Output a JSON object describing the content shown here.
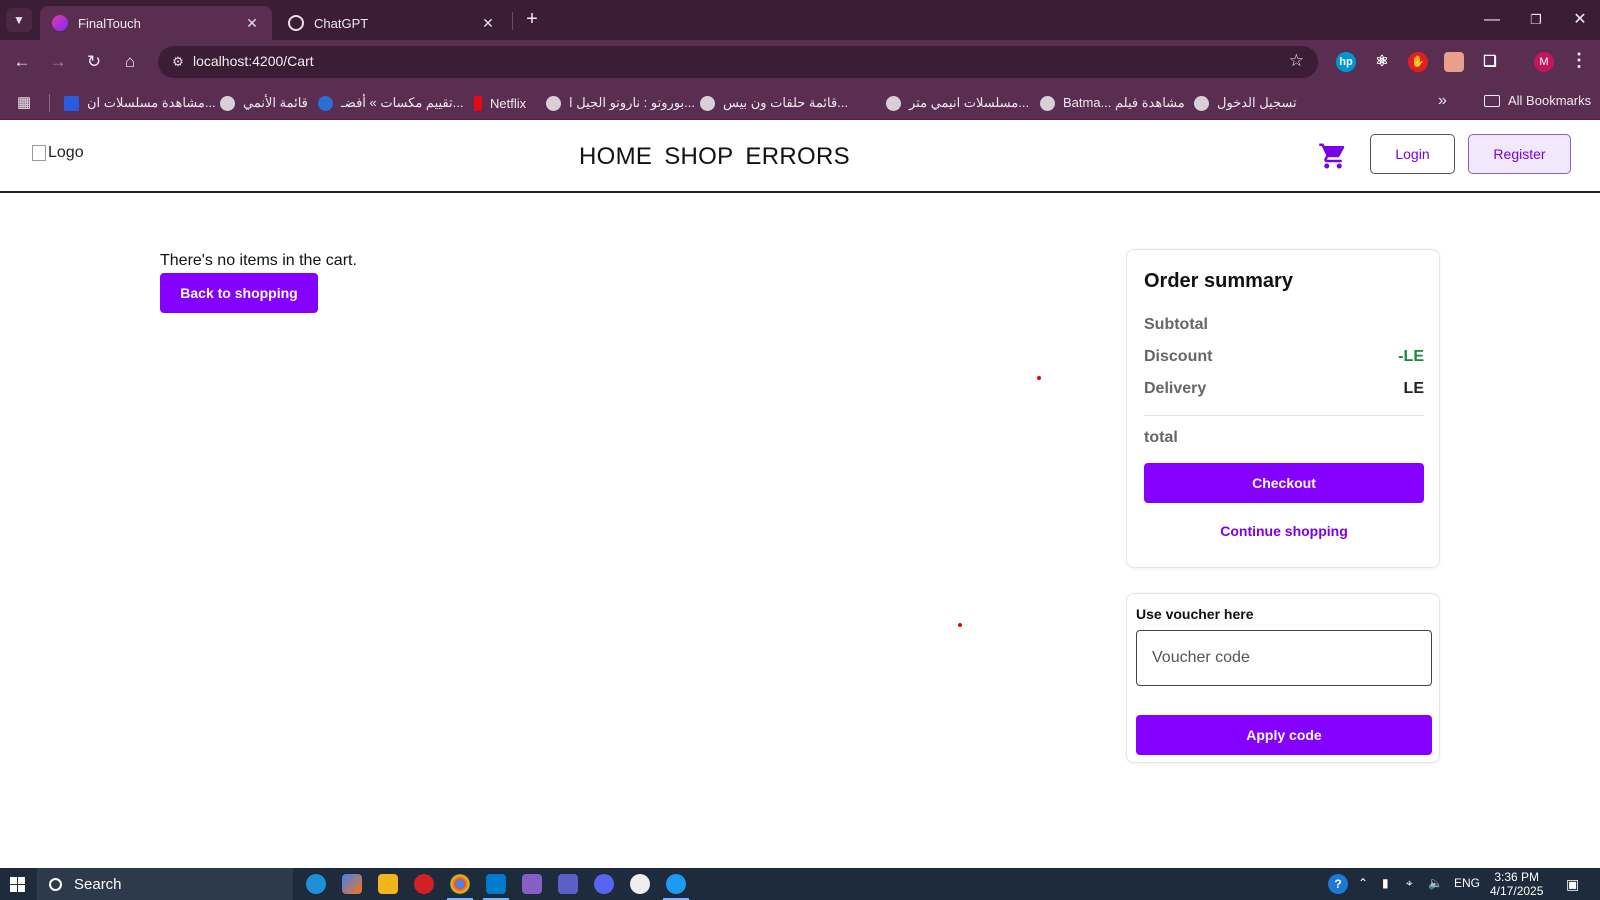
{
  "browser": {
    "tabs": [
      {
        "title": "FinalTouch",
        "active": true
      },
      {
        "title": "ChatGPT",
        "active": false
      }
    ],
    "url": "localhost:4200/Cart",
    "profile_initial": "M",
    "bookmarks": [
      "مشاهدة مسلسلات ان...",
      "قائمة الأنمي",
      "تقييم مكسات » أفضـ...",
      "Netflix",
      "بوروتو : ناروتو الجيل ا...",
      "قائمة حلقات ون بيس...",
      "مسلسلات انيمي متر...",
      "Batma... مشاهدة فيلم",
      "تسجيل الدخول"
    ],
    "all_bookmarks_label": "All Bookmarks"
  },
  "header": {
    "logo_alt": "Logo",
    "nav": [
      "HOME",
      "SHOP",
      "ERRORS"
    ],
    "login_label": "Login",
    "register_label": "Register"
  },
  "cart": {
    "empty_message": "There's no items in the cart.",
    "back_button": "Back to shopping"
  },
  "summary": {
    "title": "Order summary",
    "subtotal_label": "Subtotal",
    "subtotal_value": "",
    "discount_label": "Discount",
    "discount_value": "-LE",
    "delivery_label": "Delivery",
    "delivery_value": "LE",
    "total_label": "total",
    "total_value": "",
    "checkout_button": "Checkout",
    "continue_link": "Continue shopping"
  },
  "voucher": {
    "label": "Use voucher here",
    "placeholder": "Voucher code",
    "apply_button": "Apply code"
  },
  "taskbar": {
    "search_label": "Search",
    "language": "ENG",
    "time": "3:36 PM",
    "date": "4/17/2025"
  },
  "colors": {
    "accent": "#8400ff",
    "discount_green": "#1a8a3a",
    "chrome_dark": "#3b1d35",
    "chrome_toolbar": "#5a2e51"
  }
}
